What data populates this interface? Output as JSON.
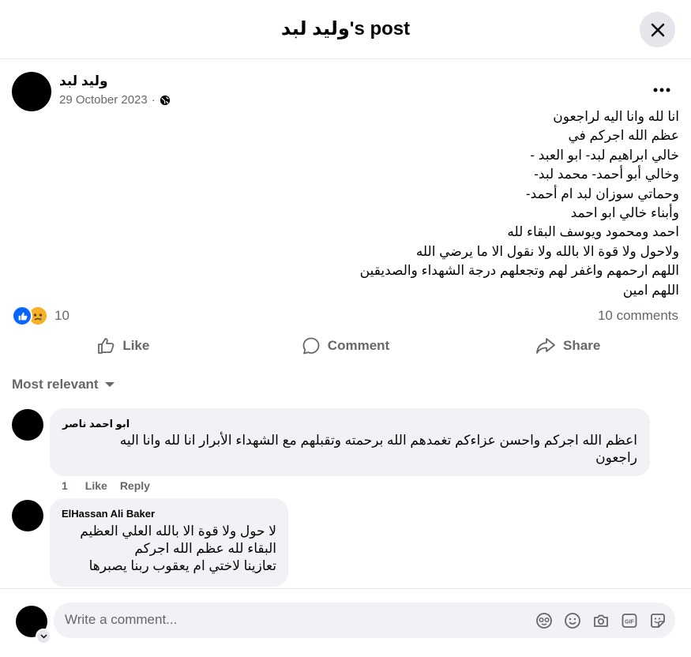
{
  "header": {
    "title": "وليد لبد's post",
    "close_icon": "close-icon"
  },
  "post": {
    "author": "وليد لبد",
    "date": "29 October 2023",
    "separator": "·",
    "privacy_icon": "globe-icon",
    "more_icon": "more-icon",
    "body_lines": [
      "انا لله وانا اليه لراجعون",
      "عظم الله اجركم في ",
      "خالي ابراهيم لبد- ابو العبد -",
      "وخالي أبو أحمد- محمد لبد-",
      "وحماتي سوزان لبد ام أحمد-",
      "وأبناء خالي ابو احمد",
      "احمد ومحمود ويوسف البقاء لله ",
      "ولاحول ولا قوة الا بالله ولا نقول الا ما يرضي الله",
      "اللهم ارحمهم واغفر لهم وتجعلهم درجة الشهداء والصديقين",
      "اللهم امين"
    ],
    "reaction_count": "10",
    "comments_count": "10 comments"
  },
  "actions": {
    "like": "Like",
    "comment": "Comment",
    "share": "Share"
  },
  "sort_label": "Most relevant",
  "comments": [
    {
      "author": "ابو احمد ناصر",
      "text_lines": [
        "اعظم الله اجركم واحسن عزاءكم تغمدهم الله برحمته وتقبلهم مع الشهداء الأبرار انا لله وانا اليه",
        "راجعون"
      ],
      "like_count": "1",
      "like_label": "Like",
      "reply_label": "Reply"
    },
    {
      "author": "ElHassan Ali Baker",
      "text_lines": [
        "لا حول ولا قوة الا بالله العلي العظيم",
        "البقاء لله عظم الله اجركم",
        "تعازينا لاختي ام يعقوب ربنا يصبرها"
      ]
    }
  ],
  "composer": {
    "placeholder": "Write a comment...",
    "icons": [
      "avatar-icon",
      "emoji-icon",
      "camera-icon",
      "gif-icon",
      "sticker-icon"
    ]
  },
  "colors": {
    "like_blue": "#0866ff",
    "sad_yellow": "#f7b125",
    "secondary_text": "#65676b",
    "bubble_bg": "#f0f2f5"
  }
}
